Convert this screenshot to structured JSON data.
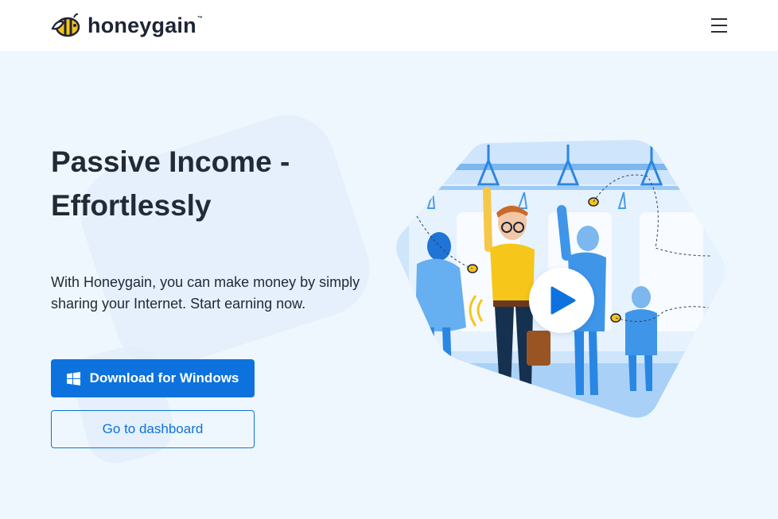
{
  "header": {
    "logo_text": "honeygain",
    "logo_tm": "™",
    "menu_icon": "hamburger-menu-icon"
  },
  "hero": {
    "title": "Passive Income - Effortlessly",
    "subtitle": "With Honeygain, you can make money by simply sharing your Internet. Start earning now.",
    "primary_button": {
      "label": "Download for Windows",
      "icon": "windows-icon"
    },
    "secondary_button": {
      "label": "Go to dashboard"
    },
    "video": {
      "icon": "play-icon"
    }
  },
  "colors": {
    "brand_blue": "#0d72de",
    "page_bg": "#eff7fe",
    "header_bg": "#ffffff",
    "text_dark": "#232a37",
    "bee_yellow": "#f7c31b"
  }
}
